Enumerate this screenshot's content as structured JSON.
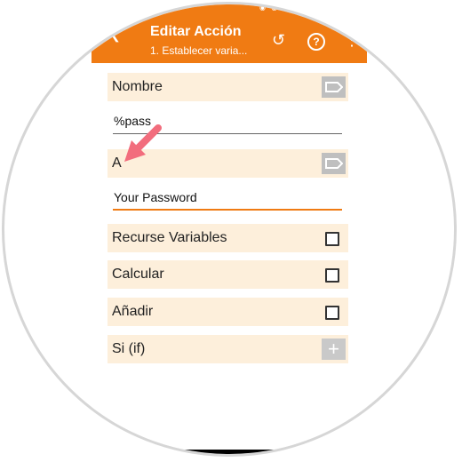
{
  "header": {
    "title": "Editar Acción",
    "subtitle": "1. Establecer varia..."
  },
  "icons": {
    "back": "back-arrow-icon",
    "undo": "undo-icon",
    "help": "help-icon",
    "more": "more-icon"
  },
  "fields": {
    "nombre_label": "Nombre",
    "nombre_value": "%pass",
    "a_label": "A",
    "a_value": "Your Password"
  },
  "options": {
    "recurse_label": "Recurse Variables",
    "calcular_label": "Calcular",
    "anadir_label": "Añadir",
    "si_label": "Si (if)"
  },
  "colors": {
    "accent": "#f07b13",
    "row_background": "#fdefdb",
    "annotation_arrow": "#f26d7d"
  }
}
